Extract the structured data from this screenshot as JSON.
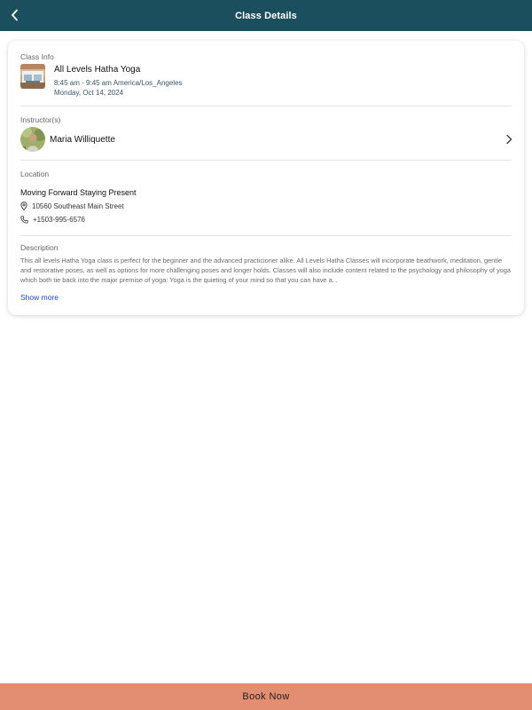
{
  "header": {
    "title": "Class Details",
    "back_icon": "chevron-left-icon"
  },
  "class_info": {
    "label": "Class Info",
    "name": "All Levels Hatha Yoga",
    "time": "8:45 am - 9:45 am America/Los_Angeles",
    "date": "Monday, Oct 14, 2024"
  },
  "instructor": {
    "label": "Instructor(s)",
    "name": "Maria Williquette"
  },
  "location": {
    "label": "Location",
    "name": "Moving Forward Staying Present",
    "address": "10560 Southeast Main Street",
    "phone": "+1503-995-6576"
  },
  "description": {
    "label": "Description",
    "text": "This all levels Hatha Yoga class is perfect for the beginner and the advanced practicioner alike. All Levels Hatha Classes will incorporate beathwork, meditation, gentle and restorative poses, as well as options for more challenging poses and longer holds. Classes will also include content related to the psychology and philosophy of yoga which both tie back into the major premise of yoga: Yoga is the quieting of your mind so that you can have a...",
    "show_more": "Show more"
  },
  "footer": {
    "book_label": "Book Now"
  },
  "colors": {
    "header_bg": "#1c4f5e",
    "book_bg": "#e38e72",
    "link": "#1a44c4"
  }
}
